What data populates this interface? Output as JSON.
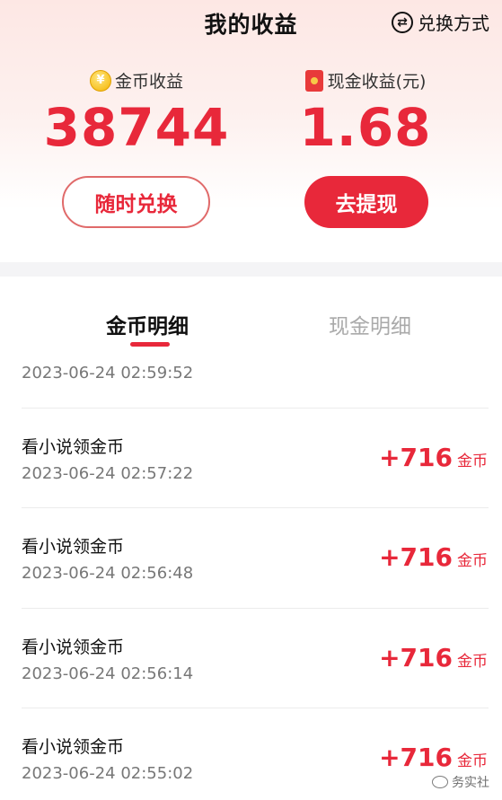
{
  "header": {
    "title": "我的收益",
    "exchange_way_label": "兑换方式",
    "exchange_icon": "⇄"
  },
  "summary": {
    "coin": {
      "label": "金币收益",
      "value": "38744",
      "icon": "¥"
    },
    "cash": {
      "label": "现金收益(元)",
      "value": "1.68"
    }
  },
  "actions": {
    "exchange_label": "随时兑换",
    "withdraw_label": "去提现"
  },
  "tabs": [
    {
      "label": "金币明细",
      "active": true
    },
    {
      "label": "现金明细",
      "active": false
    }
  ],
  "records": {
    "partial_top_date": "2023-06-24 02:59:52",
    "items": [
      {
        "title": "看小说领金币",
        "date": "2023-06-24 02:57:22",
        "amount": "+716",
        "unit": "金币"
      },
      {
        "title": "看小说领金币",
        "date": "2023-06-24 02:56:48",
        "amount": "+716",
        "unit": "金币"
      },
      {
        "title": "看小说领金币",
        "date": "2023-06-24 02:56:14",
        "amount": "+716",
        "unit": "金币"
      },
      {
        "title": "看小说领金币",
        "date": "2023-06-24 02:55:02",
        "amount": "+716",
        "unit": "金币"
      }
    ]
  },
  "watermark": "务实社",
  "colors": {
    "accent": "#e8283a",
    "coin": "#f4b400"
  }
}
